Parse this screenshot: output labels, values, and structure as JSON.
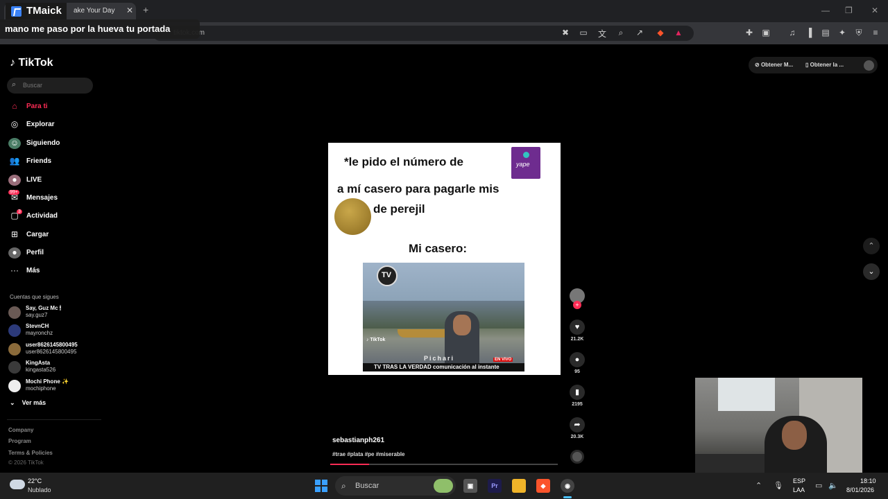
{
  "browser": {
    "tab_title": "ake Your Day",
    "url": "tiktok.com"
  },
  "overlay": {
    "logo_text": "TMaick",
    "caption": "mano me paso por la hueva tu portada"
  },
  "sidebar": {
    "logo": "TikTok",
    "search_placeholder": "Buscar",
    "nav": [
      {
        "label": "Para ti",
        "icon": "home-icon"
      },
      {
        "label": "Explorar",
        "icon": "compass-icon"
      },
      {
        "label": "Siguiendo",
        "icon": "following-icon"
      },
      {
        "label": "Friends",
        "icon": "friends-icon"
      },
      {
        "label": "LIVE",
        "icon": "live-icon"
      },
      {
        "label": "Mensajes",
        "icon": "messages-icon",
        "badge": "99+"
      },
      {
        "label": "Actividad",
        "icon": "activity-icon",
        "badge": "3"
      },
      {
        "label": "Cargar",
        "icon": "upload-icon"
      },
      {
        "label": "Perfil",
        "icon": "profile-icon"
      },
      {
        "label": "Más",
        "icon": "more-icon"
      }
    ],
    "following_title": "Cuentas que sigues",
    "following": [
      {
        "name": "Say, Guz Mc 🕯",
        "handle": "say.guz7"
      },
      {
        "name": "StevnCH",
        "handle": "mayronchz"
      },
      {
        "name": "user8626145800495",
        "handle": "user8626145800495"
      },
      {
        "name": "KingAsta",
        "handle": "kingasta526"
      },
      {
        "name": "Mochi Phone ✨",
        "handle": "mochiphone"
      }
    ],
    "see_more": "Ver más",
    "footer": [
      "Company",
      "Program",
      "Terms & Policies",
      "© 2026 TikTok"
    ]
  },
  "top_right": {
    "pill1": "Obtener M...",
    "pill2": "Obtener la ..."
  },
  "video": {
    "line1": "*le pido el número de",
    "line2": "a mí casero para pagarle mis",
    "line3": "de perejil",
    "line4": "Mi casero:",
    "yape_label": "yape",
    "coin_label": "1 Sol",
    "clip_logo": "TV",
    "clip_location": "Pichari",
    "clip_ticker": "TV TRAS LA VERDAD comunicación al instante",
    "clip_live": "EN VIVO",
    "clip_watermark": "♪ TikTok"
  },
  "actions": {
    "likes": "21.2K",
    "comments": "95",
    "saves": "2195",
    "shares": "20.3K"
  },
  "post": {
    "author": "sebastianph261",
    "tags": "#trae #plata #pe #miserable",
    "progress": 0.17
  },
  "taskbar": {
    "temp": "22°C",
    "weather": "Nublado",
    "search_placeholder": "Buscar",
    "lang1": "ESP",
    "lang2": "LAA",
    "time": "18:10",
    "date": "8/01/2026"
  },
  "colors": {
    "accent": "#fe2c55",
    "background": "#000000"
  }
}
